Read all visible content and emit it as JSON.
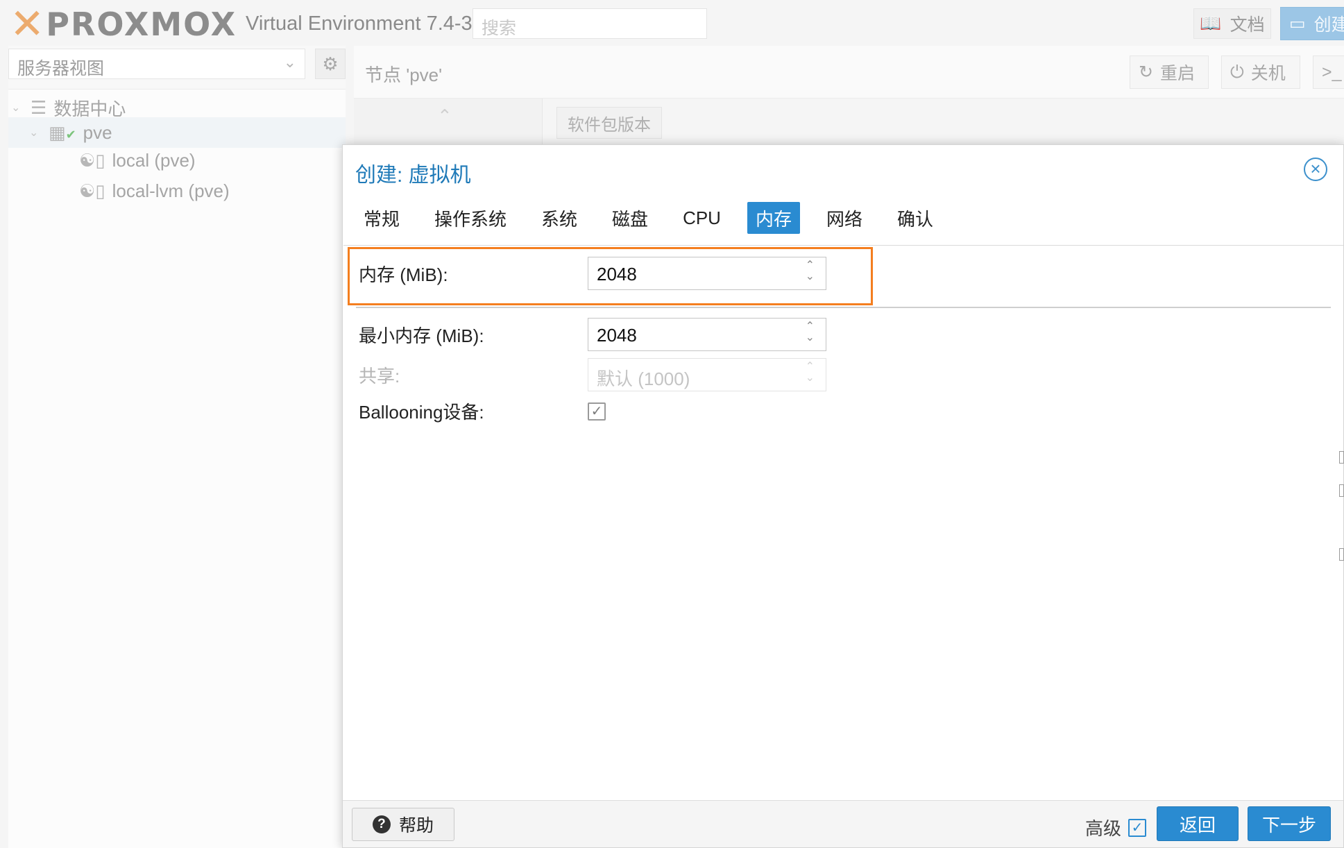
{
  "app": {
    "logo_text": "PROXMOX",
    "version": "Virtual Environment 7.4-3",
    "search_placeholder": "搜索",
    "docs_label": "文档",
    "create_label": "创建"
  },
  "sidebar": {
    "view_label": "服务器视图",
    "tree": [
      {
        "label": "数据中心",
        "icon": "datacenter-icon"
      },
      {
        "label": "pve",
        "icon": "node-icon",
        "status": "online"
      },
      {
        "label": "local (pve)",
        "icon": "storage-icon"
      },
      {
        "label": "local-lvm (pve)",
        "icon": "storage-icon"
      }
    ]
  },
  "main": {
    "node_title": "节点 'pve'",
    "reboot_label": "重启",
    "shutdown_label": "关机",
    "shell_label": ">_",
    "package_versions_label": "软件包版本"
  },
  "dialog": {
    "title": "创建: 虚拟机",
    "tabs": [
      {
        "label": "常规"
      },
      {
        "label": "操作系统"
      },
      {
        "label": "系统"
      },
      {
        "label": "磁盘"
      },
      {
        "label": "CPU"
      },
      {
        "label": "内存"
      },
      {
        "label": "网络"
      },
      {
        "label": "确认"
      }
    ],
    "active_tab": "内存",
    "fields": {
      "memory": {
        "label": "内存 (MiB):",
        "value": "2048"
      },
      "min_memory": {
        "label": "最小内存 (MiB):",
        "value": "2048"
      },
      "shares": {
        "label": "共享:",
        "placeholder": "默认 (1000)",
        "disabled": true
      },
      "ballooning": {
        "label": "Ballooning设备:",
        "checked": true
      }
    },
    "footer": {
      "help_label": "帮助",
      "advanced_label": "高级",
      "advanced_checked": true,
      "back_label": "返回",
      "next_label": "下一步"
    }
  },
  "colors": {
    "accent": "#2a8bd1",
    "highlight_border": "#f47e1f",
    "brand_orange": "#e57000"
  }
}
